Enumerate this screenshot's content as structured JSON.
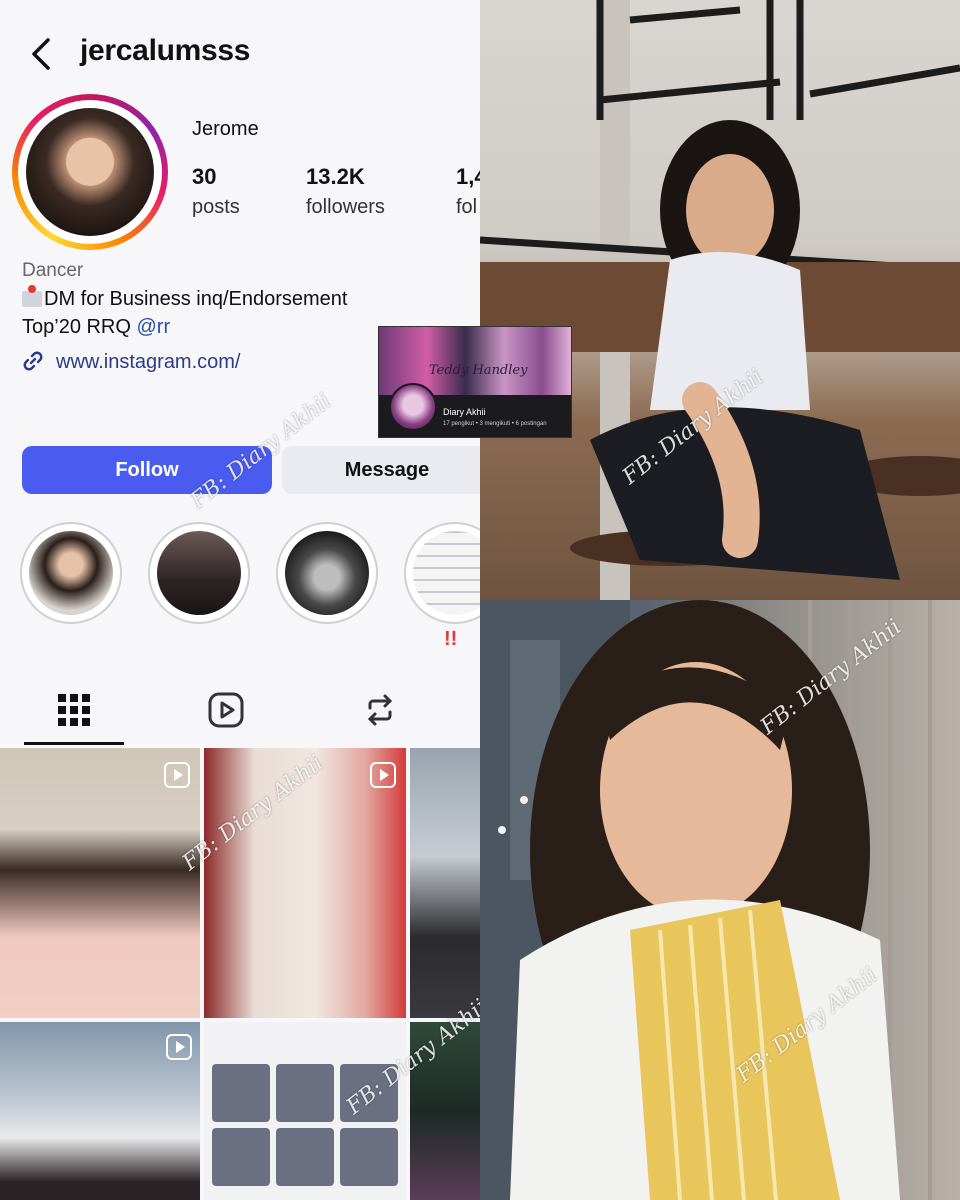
{
  "profile": {
    "username": "jercalumsss",
    "display_name": "Jerome",
    "stats": [
      {
        "value": "30",
        "label": "posts"
      },
      {
        "value": "13.2K",
        "label": "followers"
      },
      {
        "value": "1,4",
        "label": "fol"
      }
    ],
    "category": "Dancer",
    "bio_line1": "DM for Business inq/Endorsement",
    "bio_line2_prefix": "Top’20 RRQ ",
    "bio_line2_mention": "@rr",
    "link": "www.instagram.com/",
    "follow_label": "Follow",
    "message_label": "Message",
    "highlight_alert": "!!",
    "tabs": [
      "grid-icon",
      "reels-icon",
      "tagged-icon"
    ]
  },
  "inset_card": {
    "banner_text": "Teddy Handley",
    "name": "Diary Akhii",
    "meta": "17 pengikut • 3 mengikuti • 6 postingan"
  },
  "watermark": "FB: Diary Akhii",
  "colors": {
    "follow_button": "#4a5cf0",
    "message_button": "#e9ebf0",
    "link": "#2b3a8c",
    "alert": "#e53935"
  }
}
